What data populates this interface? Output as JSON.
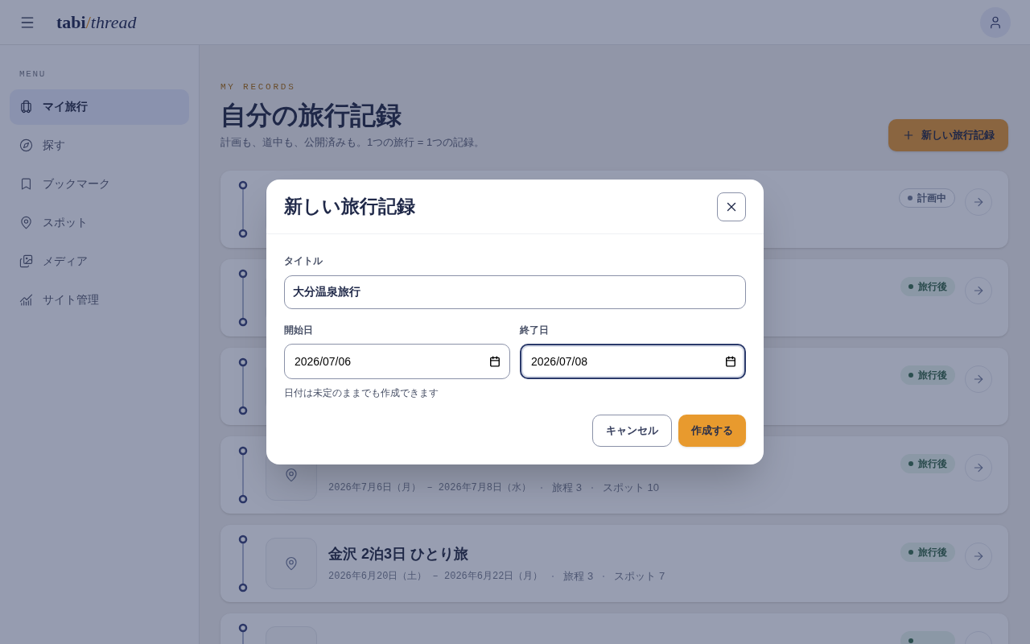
{
  "header": {
    "logo": {
      "brand": "tabi",
      "separator": "/",
      "suffix": "thread"
    }
  },
  "sidebar": {
    "heading": "MENU",
    "items": [
      {
        "label": "マイ旅行",
        "selected": true
      },
      {
        "label": "探す",
        "selected": false
      },
      {
        "label": "ブックマーク",
        "selected": false
      },
      {
        "label": "スポット",
        "selected": false
      },
      {
        "label": "メディア",
        "selected": false
      },
      {
        "label": "サイト管理",
        "selected": false
      }
    ]
  },
  "main": {
    "eyebrow": "MY RECORDS",
    "title": "自分の旅行記録",
    "subtitle": "計画も、道中も、公開済みも。1つの旅行 = 1つの記録。",
    "new_button": "新しい旅行記録",
    "trips": [
      {
        "status": {
          "label": "計画中",
          "kind": "planning"
        }
      },
      {
        "status": {
          "label": "旅行後",
          "kind": "done"
        }
      },
      {
        "status": {
          "label": "旅行後",
          "kind": "done"
        }
      },
      {
        "dates": "2026年7月6日（月） – 2026年7月8日（水）",
        "plans": "旅程 3",
        "spots": "スポット 10",
        "status": {
          "label": "旅行後",
          "kind": "done"
        }
      },
      {
        "title": "金沢 2泊3日 ひとり旅",
        "dates": "2026年6月20日（土） – 2026年6月22日（月）",
        "plans": "旅程 3",
        "spots": "スポット 7",
        "status": {
          "label": "旅行後",
          "kind": "done"
        }
      },
      {
        "status": {
          "kind": "done"
        }
      }
    ]
  },
  "dialog": {
    "title": "新しい旅行記録",
    "title_field": {
      "label": "タイトル",
      "value": "大分温泉旅行"
    },
    "start_field": {
      "label": "開始日",
      "value": "2026/07/06",
      "focused": false
    },
    "end_field": {
      "label": "終了日",
      "value": "2026/07/08",
      "focused": true
    },
    "hint": "日付は未定のままでも作成できます",
    "cancel": "キャンセル",
    "submit": "作成する"
  }
}
